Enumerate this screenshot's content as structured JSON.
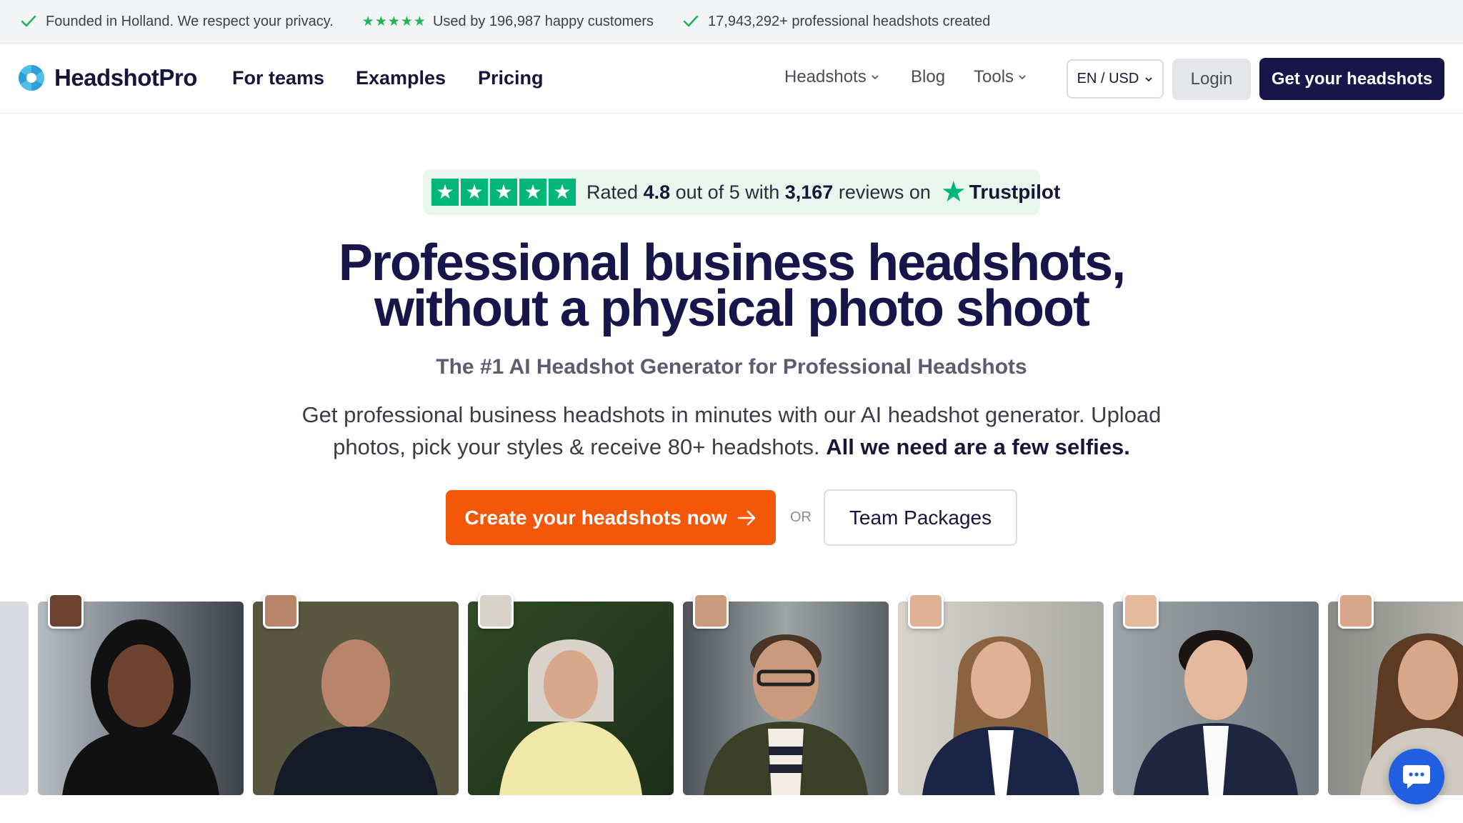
{
  "topbar": {
    "item1": "Founded in Holland. We respect your privacy.",
    "item2_stars": "★★★★★",
    "item2": "Used by 196,987 happy customers",
    "item3": "17,943,292+ professional headshots created"
  },
  "nav": {
    "logo": "HeadshotPro",
    "for_teams": "For teams",
    "examples": "Examples",
    "pricing": "Pricing",
    "headshots": "Headshots",
    "blog": "Blog",
    "tools": "Tools",
    "lang": "EN / USD",
    "login": "Login",
    "get": "Get your headshots"
  },
  "trustpilot": {
    "prefix": "Rated",
    "rating": "4.8",
    "mid": "out of 5 with",
    "count": "3,167",
    "suffix": "reviews on",
    "brand": "Trustpilot"
  },
  "hero": {
    "title_line1": "Professional business headshots,",
    "title_line2": "without a physical photo shoot",
    "subtitle": "The #1 AI Headshot Generator for Professional Headshots",
    "desc": "Get professional business headshots in minutes with our AI headshot generator. Upload photos, pick your styles & receive 80+ headshots.",
    "desc_bold": "All we need are a few selfies.",
    "cta": "Create your headshots now",
    "or": "OR",
    "team": "Team Packages"
  },
  "colors": {
    "brand_navy": "#17154a",
    "cta_orange": "#f4570a",
    "trust_green": "#00b67a",
    "check_green": "#22b45c"
  }
}
